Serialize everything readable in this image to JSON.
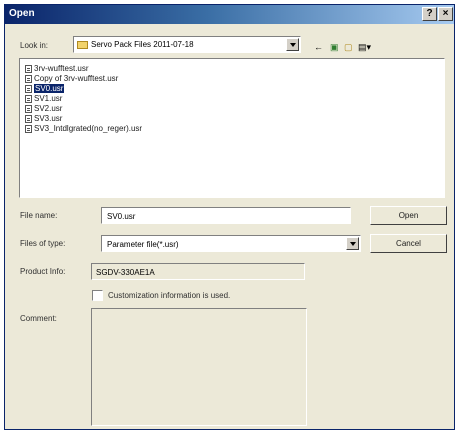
{
  "window": {
    "title": "Open",
    "help_label": "?",
    "close_label": "×"
  },
  "look_in": {
    "label": "Look in:",
    "value": "Servo Pack Files 2011-07-18"
  },
  "toolbar": {
    "back_glyph": "←",
    "up_glyph": "▣",
    "new_folder_glyph": "▢",
    "view_glyph": "▤▾"
  },
  "files": [
    {
      "name": "3rv-wufftest.usr",
      "selected": false
    },
    {
      "name": "Copy of 3rv-wufftest.usr",
      "selected": false
    },
    {
      "name": "SV0.usr",
      "selected": true
    },
    {
      "name": "SV1.usr",
      "selected": false
    },
    {
      "name": "SV2.usr",
      "selected": false
    },
    {
      "name": "SV3.usr",
      "selected": false
    },
    {
      "name": "SV3_Intdlgrated(no_reger).usr",
      "selected": false
    }
  ],
  "file_name": {
    "label": "File name:",
    "value": "SV0.usr"
  },
  "file_type": {
    "label": "Files of type:",
    "value": "Parameter file(*.usr)"
  },
  "buttons": {
    "open": "Open",
    "cancel": "Cancel"
  },
  "product_info": {
    "label": "Product Info:",
    "value": "SGDV-330AE1A"
  },
  "customization": {
    "label": "Customization information is used.",
    "checked": false
  },
  "comment": {
    "label": "Comment:",
    "value": ""
  }
}
